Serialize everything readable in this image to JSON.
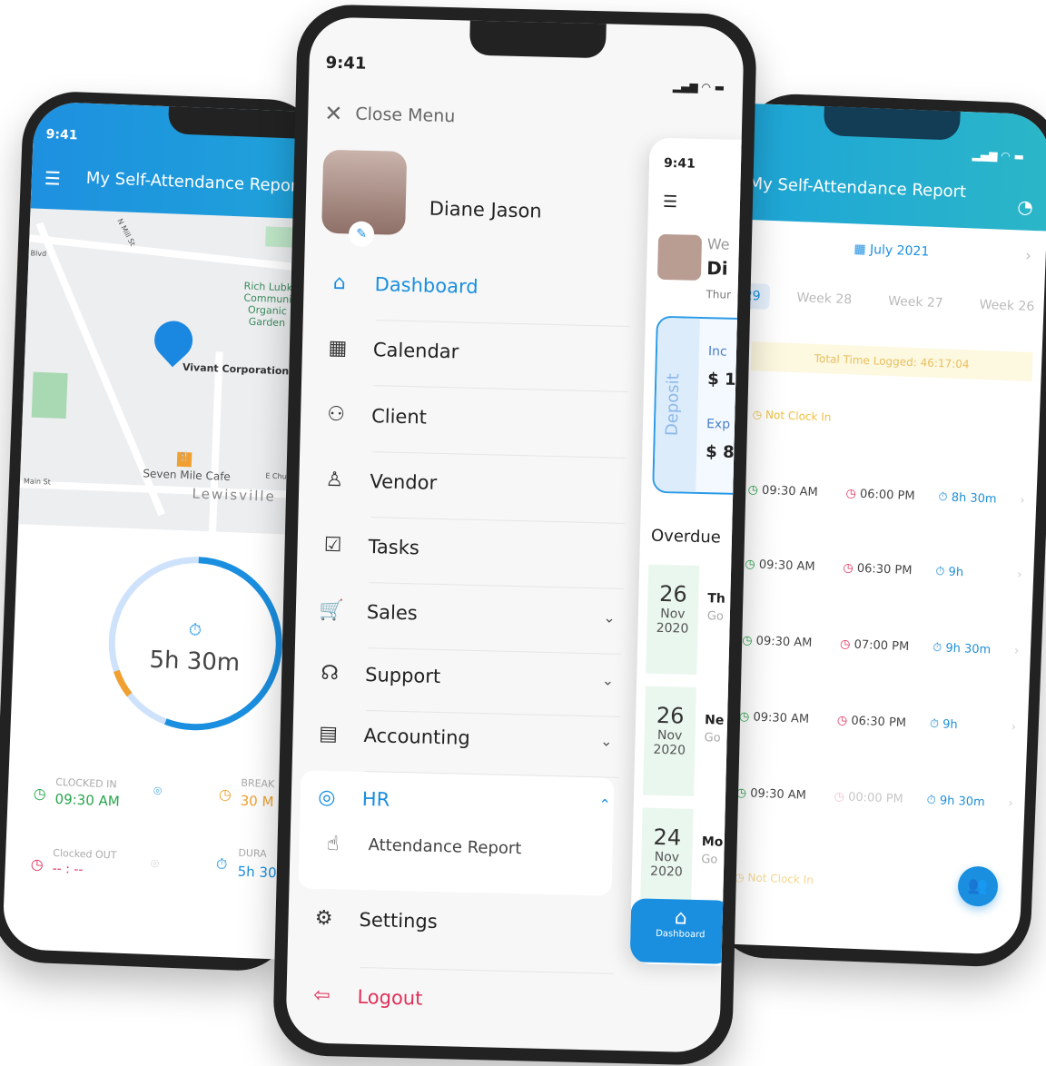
{
  "status_time": "9:41",
  "left_phone": {
    "title": "My Self-Attendance Report",
    "map_labels": {
      "street1": "N Mill St",
      "street2": "Blvd",
      "garden": "Rich Lubk Communi Organic Garden",
      "location": "Vivant Corporation",
      "cafe": "Seven Mile Cafe",
      "street3": "Main St",
      "street4": "E Chur",
      "city": "Lewisville"
    },
    "timer": "5h 30m",
    "timer_progress": 0.92,
    "clocked_in_label": "CLOCKED IN",
    "clocked_in_value": "09:30 AM",
    "break_label": "BREAK",
    "break_value": "30 M",
    "clocked_out_label": "Clocked OUT",
    "clocked_out_value": "-- : --",
    "duration_label": "DURA",
    "duration_value": "5h 30"
  },
  "menu": {
    "close_label": "Close Menu",
    "user_name": "Diane Jason",
    "items": [
      {
        "label": "Dashboard",
        "icon": "home-icon",
        "active": true
      },
      {
        "label": "Calendar",
        "icon": "calendar-icon"
      },
      {
        "label": "Client",
        "icon": "users-icon"
      },
      {
        "label": "Vendor",
        "icon": "vendor-icon"
      },
      {
        "label": "Tasks",
        "icon": "clipboard-check-icon"
      },
      {
        "label": "Sales",
        "icon": "cart-icon",
        "expandable": true
      },
      {
        "label": "Support",
        "icon": "headset-icon",
        "expandable": true
      },
      {
        "label": "Accounting",
        "icon": "calculator-icon",
        "expandable": true
      },
      {
        "label": "HR",
        "icon": "hr-icon",
        "expanded": true
      },
      {
        "label": "Attendance Report",
        "icon": "fingerprint-icon",
        "sub": true
      },
      {
        "label": "Settings",
        "icon": "gear-icon"
      },
      {
        "label": "Logout",
        "icon": "logout-icon"
      }
    ],
    "accent": "#1a8fe0"
  },
  "mini_phone": {
    "welcome": "We",
    "name": "Di",
    "date": "Thur",
    "deposit": "Deposit",
    "income_label": "Inc",
    "income_value": "$ 1",
    "expense_label": "Exp",
    "expense_value": "$ 8",
    "overdue_title": "Overdue",
    "overdue": [
      {
        "day": "26",
        "month": "Nov",
        "year": "2020",
        "title": "Th",
        "sub": "Go"
      },
      {
        "day": "26",
        "month": "Nov",
        "year": "2020",
        "title": "Ne",
        "sub": "Go"
      },
      {
        "day": "24",
        "month": "Nov",
        "year": "2020",
        "title": "Mo",
        "sub": "Go"
      }
    ],
    "nav_label": "Dashboard"
  },
  "right_phone": {
    "title": "My Self-Attendance Report",
    "month": "July 2021",
    "weeks": [
      "29",
      "Week 28",
      "Week 27",
      "Week 26"
    ],
    "total": "Total Time Logged: 46:17:04",
    "not_clock_in": "Not Clock In",
    "rows": [
      {
        "in": "09:30 AM",
        "out": "06:00 PM",
        "dur": "8h 30m"
      },
      {
        "in": "09:30 AM",
        "out": "06:30 PM",
        "dur": "9h"
      },
      {
        "in": "09:30 AM",
        "out": "07:00 PM",
        "dur": "9h 30m"
      },
      {
        "in": "09:30 AM",
        "out": "06:30 PM",
        "dur": "9h"
      },
      {
        "in": "09:30 AM",
        "out": "00:00 PM",
        "dur": "9h 30m"
      }
    ]
  }
}
